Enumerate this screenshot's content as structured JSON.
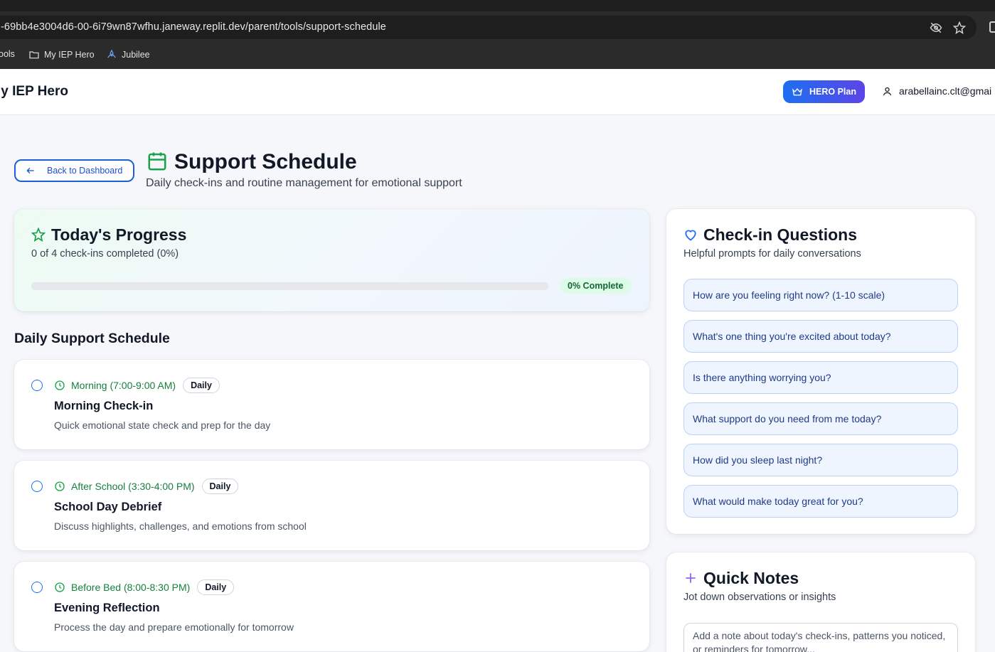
{
  "browser": {
    "url": "-69bb4e3004d6-00-6i79wn87wfhu.janeway.replit.dev/parent/tools/support-schedule",
    "bookmarks": [
      {
        "label": "ools",
        "icon": "none"
      },
      {
        "label": "My IEP Hero",
        "icon": "folder-icon"
      },
      {
        "label": "Jubilee",
        "icon": "jubilee-icon"
      }
    ]
  },
  "header": {
    "app_title": "ly IEP Hero",
    "plan_label": "HERO Plan",
    "user_email": "arabellainc.clt@gmai"
  },
  "page": {
    "back_label": "Back to Dashboard",
    "title": "Support Schedule",
    "subtitle": "Daily check-ins and routine management for emotional support"
  },
  "progress": {
    "title": "Today's Progress",
    "summary": "0 of 4 check-ins completed (0%)",
    "percent": 0,
    "badge": "0% Complete"
  },
  "schedule": {
    "title": "Daily Support Schedule",
    "items": [
      {
        "time": "Morning (7:00-9:00 AM)",
        "frequency": "Daily",
        "title": "Morning Check-in",
        "description": "Quick emotional state check and prep for the day",
        "completed": false
      },
      {
        "time": "After School (3:30-4:00 PM)",
        "frequency": "Daily",
        "title": "School Day Debrief",
        "description": "Discuss highlights, challenges, and emotions from school",
        "completed": false
      },
      {
        "time": "Before Bed (8:00-8:30 PM)",
        "frequency": "Daily",
        "title": "Evening Reflection",
        "description": "Process the day and prepare emotionally for tomorrow",
        "completed": false
      }
    ]
  },
  "questions": {
    "title": "Check-in Questions",
    "subtitle": "Helpful prompts for daily conversations",
    "items": [
      "How are you feeling right now? (1-10 scale)",
      "What's one thing you're excited about today?",
      "Is there anything worrying you?",
      "What support do you need from me today?",
      "How did you sleep last night?",
      "What would make today great for you?"
    ]
  },
  "notes": {
    "title": "Quick Notes",
    "subtitle": "Jot down observations or insights",
    "placeholder": "Add a note about today's check-ins, patterns you noticed, or reminders for tomorrow..."
  },
  "colors": {
    "accent_blue": "#1d6ff2",
    "accent_green": "#16a34a",
    "accent_purple": "#8b5cf6"
  }
}
